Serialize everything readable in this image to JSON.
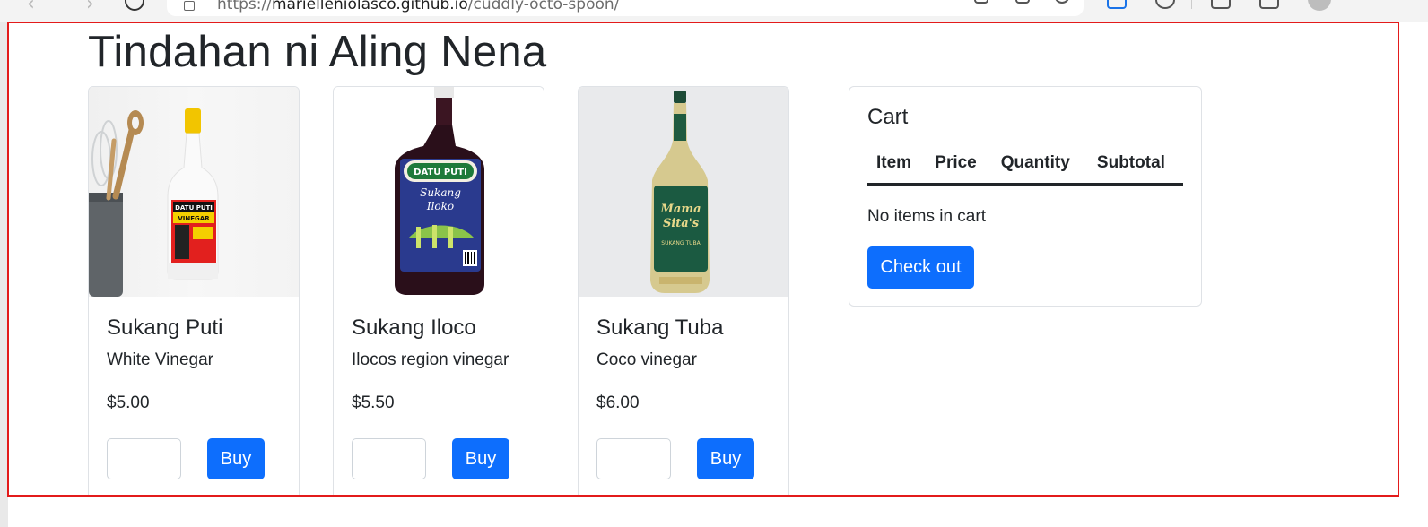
{
  "browser": {
    "url_prefix": "https://",
    "url_host": "marielleniolasco.github.io",
    "url_path": "/cuddly-octo-spoon/"
  },
  "page": {
    "title": "Tindahan ni Aling Nena"
  },
  "products": [
    {
      "name": "Sukang Puti",
      "description": "White Vinegar",
      "price": "$5.00",
      "buy_label": "Buy",
      "label_text": "DATU PUTI VINEGAR"
    },
    {
      "name": "Sukang Iloco",
      "description": "Ilocos region vinegar",
      "price": "$5.50",
      "buy_label": "Buy",
      "label_text": "DATU PUTI Sukang Iloko"
    },
    {
      "name": "Sukang Tuba",
      "description": "Coco vinegar",
      "price": "$6.00",
      "buy_label": "Buy",
      "label_text": "Mama Sita's SUKANG TUBA"
    }
  ],
  "cart": {
    "title": "Cart",
    "columns": [
      "Item",
      "Price",
      "Quantity",
      "Subtotal"
    ],
    "empty_message": "No items in cart",
    "checkout_label": "Check out"
  },
  "colors": {
    "primary": "#0d6efd",
    "frame_outline": "#e31b1b",
    "text": "#212529"
  }
}
